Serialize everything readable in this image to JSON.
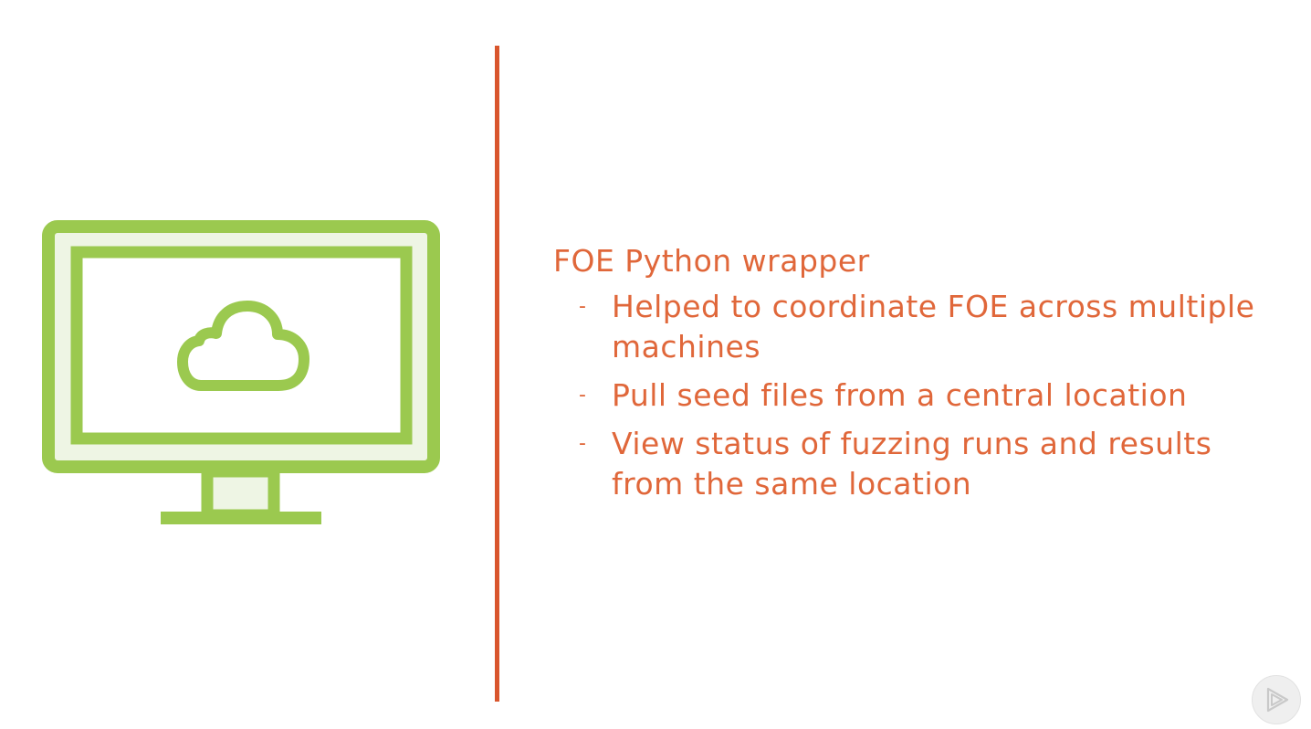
{
  "slide": {
    "heading": "FOE Python wrapper",
    "bullets": [
      {
        "marker": "-",
        "text": "Helped to coordinate FOE across multiple machines"
      },
      {
        "marker": "-",
        "text": "Pull seed files from a central location"
      },
      {
        "marker": "-",
        "text": "View status of fuzzing runs and results from the same location"
      }
    ]
  },
  "illustration": {
    "icon": "monitor-with-cloud-icon",
    "stroke_color": "#9bc94f",
    "fill_color": "#eef5e4"
  },
  "colors": {
    "divider": "#d9562d",
    "text": "#e0673a",
    "play_button_bg": "#efefef",
    "play_button_icon": "#c9c9c9"
  },
  "player": {
    "icon": "play-logo-icon"
  }
}
